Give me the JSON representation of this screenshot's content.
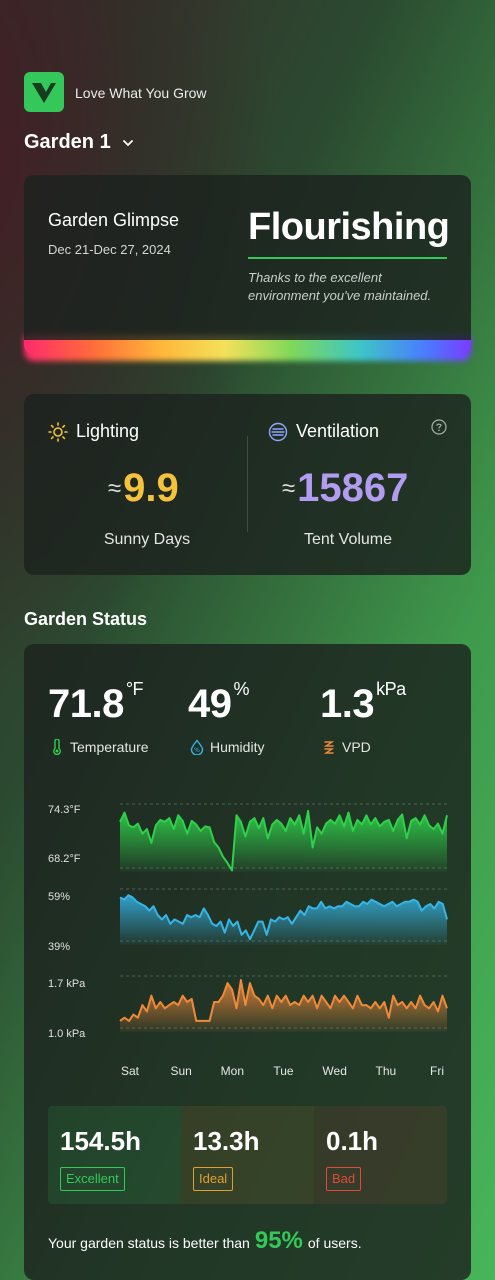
{
  "header": {
    "tagline": "Love What You Grow",
    "garden_name": "Garden 1"
  },
  "glimpse": {
    "title": "Garden Glimpse",
    "date_range": "Dec 21-Dec 27, 2024",
    "status": "Flourishing",
    "note": "Thanks to the excellent environment you've maintained."
  },
  "lighting": {
    "label": "Lighting",
    "approx": "≈",
    "value": "9.9",
    "sub": "Sunny Days"
  },
  "ventilation": {
    "label": "Ventilation",
    "approx": "≈",
    "value": "15867",
    "sub": "Tent Volume"
  },
  "section_title": "Garden Status",
  "metrics": {
    "temperature": {
      "value": "71.8",
      "unit": "°F",
      "label": "Temperature"
    },
    "humidity": {
      "value": "49",
      "unit": "%",
      "label": "Humidity"
    },
    "vpd": {
      "value": "1.3",
      "unit": "kPa",
      "label": "VPD"
    }
  },
  "chart_data": [
    {
      "type": "area",
      "series": [
        {
          "values": [
            72.8,
            73.8,
            72.4,
            72.2,
            72.6,
            71.5,
            72.0,
            70.5,
            72.4,
            73.0,
            72.8,
            73.2,
            72.0,
            73.5,
            72.9,
            71.5,
            72.9,
            72.5,
            71.8,
            72.3,
            72.2,
            70.6,
            70.0,
            69.0,
            68.3,
            67.5,
            73.5,
            72.8,
            71.2,
            72.8,
            73.2,
            72.1,
            73.2,
            71.0,
            72.5,
            73.0,
            72.6,
            71.8,
            73.2,
            72.5,
            73.5,
            71.5,
            74.0,
            70.0,
            72.2,
            71.5,
            72.6,
            73.0,
            72.6,
            73.5,
            72.3,
            73.8,
            71.8,
            73.0,
            72.5,
            73.5,
            72.5,
            73.2,
            72.3,
            72.8,
            73.0,
            71.8,
            73.0,
            73.6,
            71.0,
            72.9,
            73.2,
            72.5,
            73.5,
            72.4,
            72.0,
            72.6,
            71.5,
            73.5
          ]
        }
      ],
      "y_tick_labels": [
        "74.3°F",
        "68.2°F"
      ],
      "ylim": [
        68.2,
        74.3
      ]
    },
    {
      "type": "area",
      "series": [
        {
          "values": [
            57,
            56,
            58,
            57,
            55,
            54,
            53,
            51,
            53,
            49,
            47,
            49,
            45,
            47,
            46,
            45,
            49,
            48,
            49,
            48,
            52,
            49,
            45,
            44,
            46,
            41,
            47,
            44,
            46,
            40,
            42,
            38,
            42,
            46,
            46,
            40,
            47,
            46,
            48,
            47,
            48,
            45,
            48,
            51,
            49,
            53,
            52,
            52,
            55,
            52,
            53,
            52,
            53,
            53,
            55,
            54,
            53,
            53,
            55,
            54,
            56,
            55,
            54,
            53,
            54,
            55,
            53,
            54,
            55,
            55,
            56,
            55,
            51,
            53,
            54,
            52,
            55,
            54,
            47
          ]
        }
      ],
      "y_tick_labels": [
        "59%",
        "39%"
      ],
      "ylim": [
        39,
        59
      ]
    },
    {
      "type": "area",
      "series": [
        {
          "values": [
            1.05,
            1.1,
            1.05,
            1.15,
            1.1,
            1.3,
            1.2,
            1.45,
            1.25,
            1.35,
            1.25,
            1.3,
            1.35,
            1.3,
            1.45,
            1.35,
            1.4,
            1.05,
            1.05,
            1.05,
            1.05,
            1.35,
            1.35,
            1.45,
            1.65,
            1.55,
            1.25,
            1.7,
            1.3,
            1.65,
            1.45,
            1.4,
            1.3,
            1.45,
            1.25,
            1.45,
            1.35,
            1.45,
            1.3,
            1.35,
            1.3,
            1.45,
            1.35,
            1.45,
            1.25,
            1.45,
            1.35,
            1.25,
            1.45,
            1.35,
            1.45,
            1.35,
            1.25,
            1.45,
            1.3,
            1.3,
            1.25,
            1.35,
            1.25,
            1.35,
            1.1,
            1.45,
            1.3,
            1.35,
            1.25,
            1.35,
            1.25,
            1.45,
            1.3,
            1.25,
            1.35,
            1.2,
            1.45,
            1.25
          ]
        }
      ],
      "y_tick_labels": [
        "1.7 kPa",
        "1.0 kPa"
      ],
      "ylim": [
        1.0,
        1.7
      ]
    }
  ],
  "days": [
    "Sat",
    "Sun",
    "Mon",
    "Tue",
    "Wed",
    "Thu",
    "Fri"
  ],
  "tiles": [
    {
      "value": "154.5h",
      "label": "Excellent",
      "color": "#34c759"
    },
    {
      "value": "13.3h",
      "label": "Ideal",
      "color": "#e0a030"
    },
    {
      "value": "0.1h",
      "label": "Bad",
      "color": "#e04a3a"
    }
  ],
  "footer": {
    "prefix": "Your garden status is better than",
    "percent": "95%",
    "suffix": "of users."
  },
  "colors": {
    "accent": "#34c759",
    "lighting": "#f5c33b",
    "ventilation": "#b29cf0",
    "temperature": "#2fd04a",
    "humidity": "#35b5e8",
    "vpd": "#f08a3a"
  }
}
